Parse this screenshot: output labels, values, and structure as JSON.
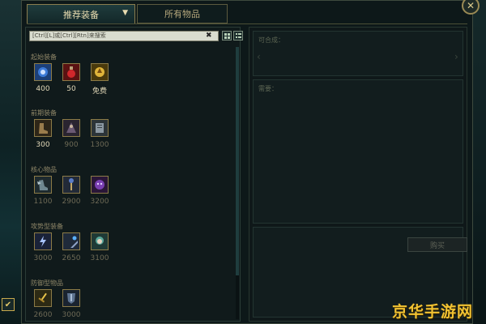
{
  "tabs": {
    "recommended": "推荐装备",
    "all_items": "所有物品"
  },
  "search": {
    "placeholder": "[Ctrl][L]或[Ctrl][Rtn]来搜索"
  },
  "categories": [
    {
      "label": "起始装备",
      "items": [
        {
          "icon": "blue-orb-icon",
          "price": "400",
          "dim": false
        },
        {
          "icon": "red-potion-icon",
          "price": "50",
          "dim": false
        },
        {
          "icon": "gold-ward-icon",
          "price": "免费",
          "dim": false
        }
      ]
    },
    {
      "label": "前期装备",
      "items": [
        {
          "icon": "boots-icon",
          "price": "300",
          "dim": false
        },
        {
          "icon": "dark-cloak-icon",
          "price": "900",
          "dim": true
        },
        {
          "icon": "tome-icon",
          "price": "1300",
          "dim": true
        }
      ]
    },
    {
      "label": "核心物品",
      "items": [
        {
          "icon": "winged-boots-icon",
          "price": "1100",
          "dim": true
        },
        {
          "icon": "staff-icon",
          "price": "2900",
          "dim": true
        },
        {
          "icon": "purple-mask-icon",
          "price": "3200",
          "dim": true
        }
      ]
    },
    {
      "label": "攻势型装备",
      "items": [
        {
          "icon": "lightning-icon",
          "price": "3000",
          "dim": true
        },
        {
          "icon": "wand-icon",
          "price": "2650",
          "dim": true
        },
        {
          "icon": "hood-icon",
          "price": "3100",
          "dim": true
        }
      ]
    },
    {
      "label": "防御型物品",
      "items": [
        {
          "icon": "golden-sword-icon",
          "price": "2600",
          "dim": true
        },
        {
          "icon": "armor-icon",
          "price": "3000",
          "dim": true
        }
      ]
    }
  ],
  "right_panel": {
    "builds_into_label": "可合成：",
    "requires_label": "需要：",
    "buy_label": "购买"
  },
  "watermark": "京华手游网",
  "colors": {
    "accent_gold": "#8c7b47",
    "panel_bg": "#101a1b",
    "watermark": "#f1c232"
  }
}
